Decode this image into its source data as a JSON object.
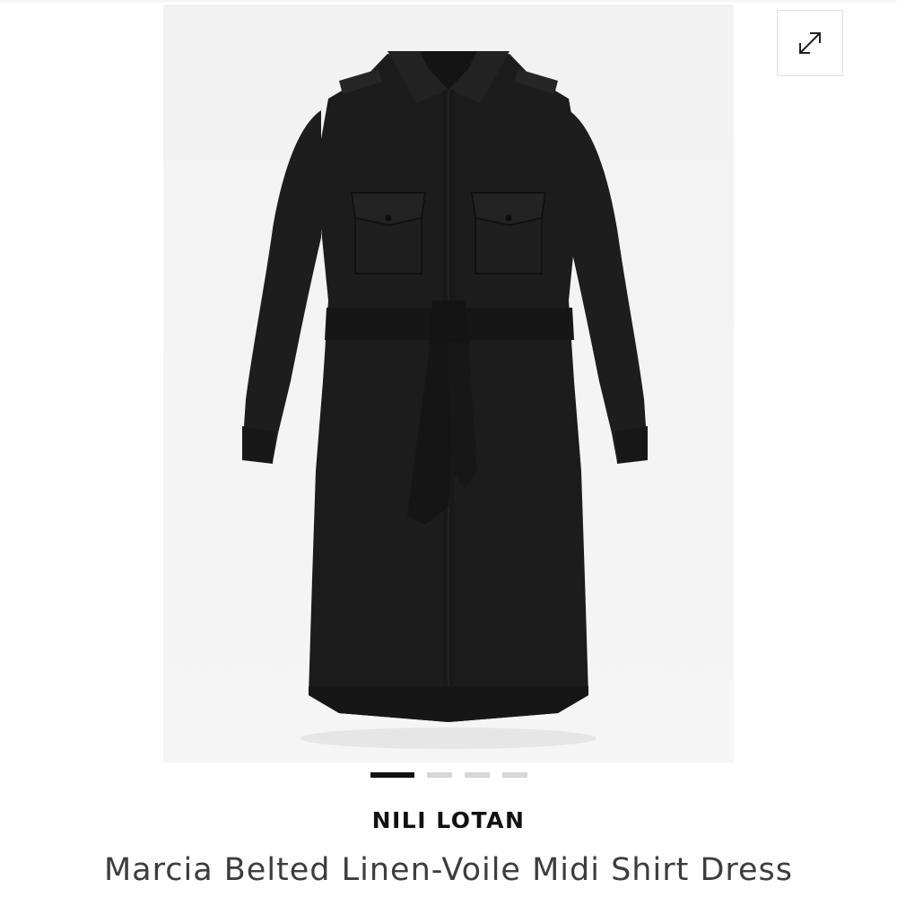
{
  "product": {
    "brand": "NILI LOTAN",
    "name": "Marcia Belted Linen-Voile Midi Shirt Dress",
    "image_alt": "black belted shirt dress"
  },
  "gallery": {
    "expand_icon": "expand-arrows-icon",
    "slide_count": 4,
    "active_slide": 1
  },
  "colors": {
    "dress": "#1b1b1b",
    "image_background": "#f3f3f3",
    "active_dot": "#111111",
    "inactive_dot": "#d6d6d6"
  }
}
